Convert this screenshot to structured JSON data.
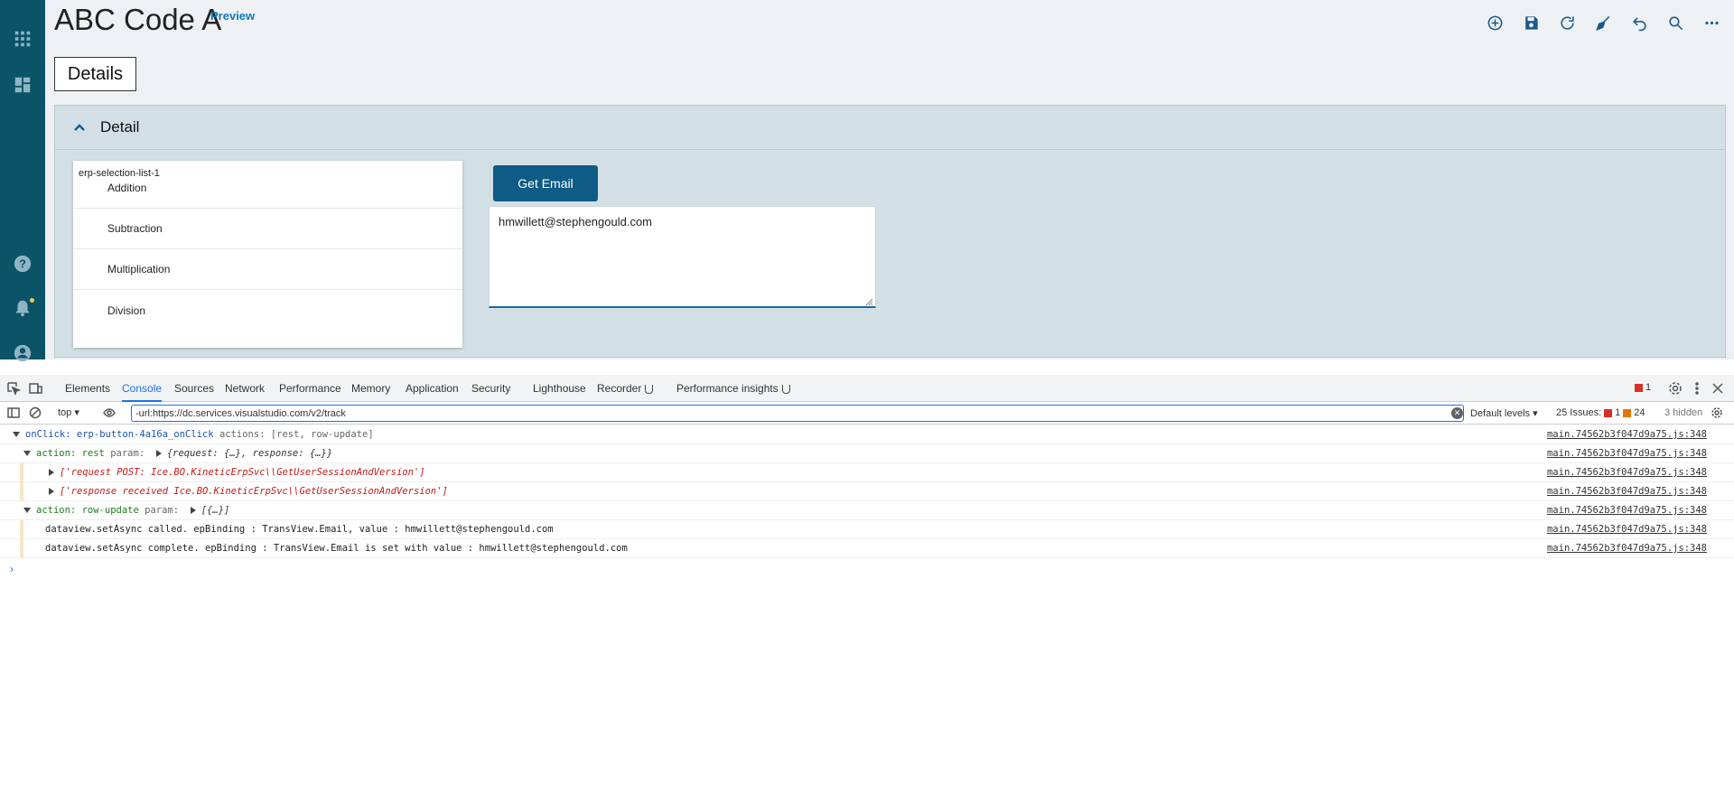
{
  "app": {
    "title": "ABC Code A",
    "preview_label": "Preview",
    "tab_label": "Details",
    "panel_title": "Detail",
    "list": {
      "label": "erp-selection-list-1",
      "items": [
        "Addition",
        "Subtraction",
        "Multiplication",
        "Division"
      ]
    },
    "get_email_label": "Get Email",
    "email_value": "hmwillett@stephengould.com",
    "toolbar_icons": [
      "add-icon",
      "save-icon",
      "refresh-icon",
      "clear-icon",
      "undo-icon",
      "search-icon",
      "more-icon"
    ]
  },
  "rail_icons": [
    "apps-icon",
    "dashboard-icon",
    "help-icon",
    "notification-icon",
    "user-icon"
  ],
  "devtools": {
    "tabs": [
      "Elements",
      "Console",
      "Sources",
      "Network",
      "Performance",
      "Memory",
      "Application",
      "Security",
      "Lighthouse",
      "Recorder",
      "Performance insights"
    ],
    "active_tab": "Console",
    "error_count": "1",
    "context": "top",
    "filter_value": "-url:https://dc.services.visualstudio.com/v2/track",
    "levels_label": "Default levels",
    "issues_label": "25 Issues:",
    "issues_errors": "1",
    "issues_warnings": "24",
    "hidden_label": "3 hidden",
    "source": "main.74562b3f047d9a75.js:348",
    "log": {
      "l1_key": "onClick:",
      "l1_name": "erp-button-4a16a_onClick",
      "l1_rest": "actions: [rest, row-update]",
      "l2_key": "action:",
      "l2_name": "rest",
      "l2_param": "param:",
      "l2_obj": "{request: {…}, response: {…}}",
      "l3": "['request POST: Ice.BO.KineticErpSvc\\\\GetUserSessionAndVersion']",
      "l4": "['response received Ice.BO.KineticErpSvc\\\\GetUserSessionAndVersion']",
      "l5_key": "action:",
      "l5_name": "row-update",
      "l5_param": "param:",
      "l5_obj": "[{…}]",
      "l6": "dataview.setAsync called. epBinding : TransView.Email, value : hmwillett@stephengould.com",
      "l7": "dataview.setAsync complete. epBinding : TransView.Email is set with value : hmwillett@stephengould.com"
    }
  }
}
